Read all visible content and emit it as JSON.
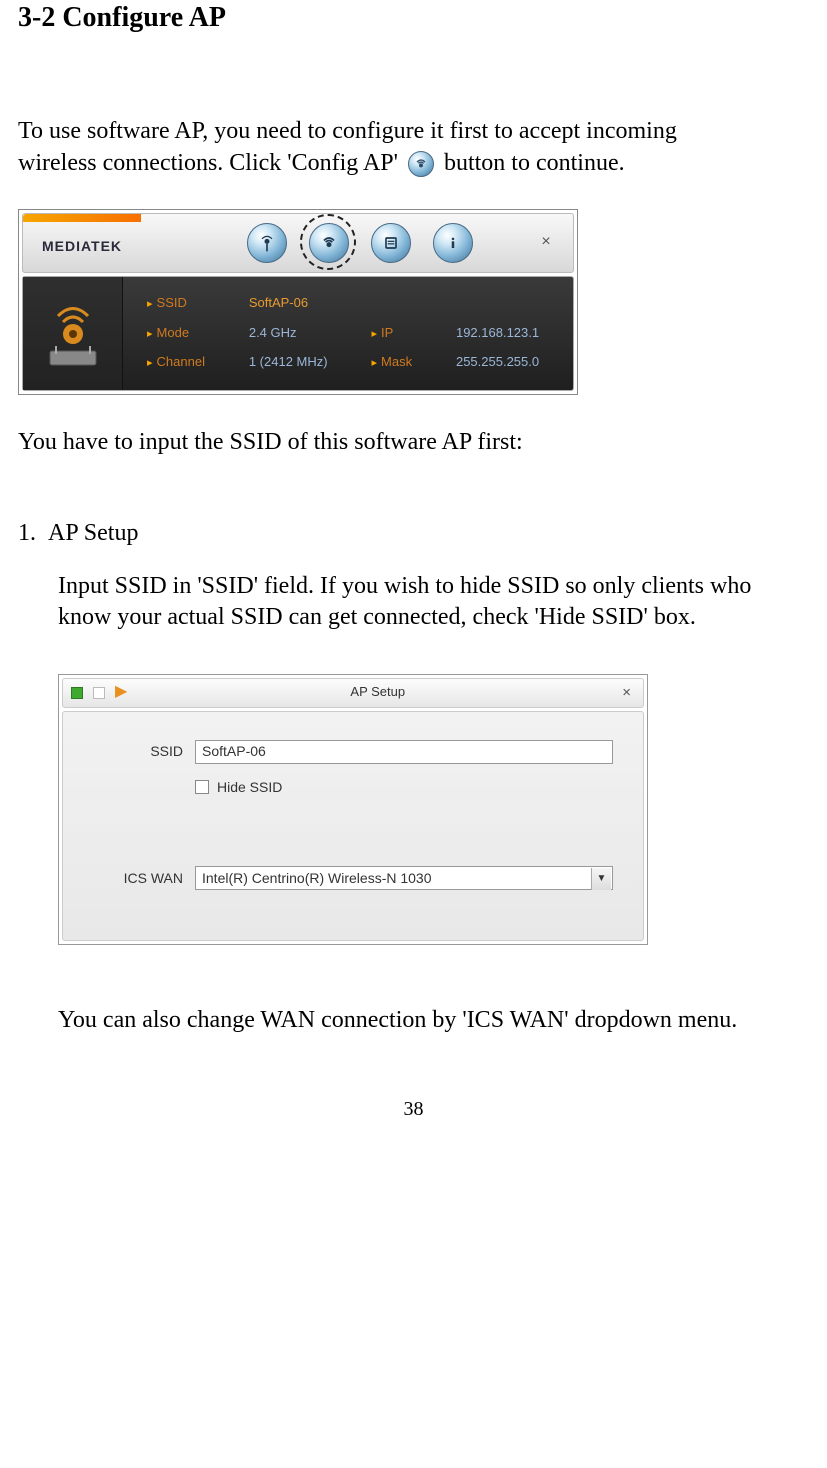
{
  "page": {
    "heading": "3-2 Configure AP",
    "intro_line1": "To use software AP, you need to configure it first to accept incoming",
    "intro_line2a": "wireless connections. Click 'Config AP' ",
    "intro_line2b": " button to continue.",
    "caption1": "You have to input the SSID of this software AP first:",
    "list_number": "1.",
    "list_title": "AP Setup",
    "para3": "Input SSID in 'SSID' field. If you wish to hide SSID so only clients who know your actual SSID can get connected, check 'Hide SSID' box.",
    "para4": "You can also change WAN connection by 'ICS WAN' dropdown menu.",
    "page_number": "38"
  },
  "shot1": {
    "brand": "MEDIATEK",
    "labels": {
      "ssid": "SSID",
      "mode": "Mode",
      "channel": "Channel",
      "ip": "IP",
      "mask": "Mask"
    },
    "values": {
      "ssid": "SoftAP-06",
      "mode": "2.4 GHz",
      "channel": "1 (2412 MHz)",
      "ip": "192.168.123.1",
      "mask": "255.255.255.0"
    },
    "close": "×"
  },
  "shot2": {
    "title": "AP Setup",
    "close": "×",
    "arrow": "▶",
    "labels": {
      "ssid": "SSID",
      "hide_ssid": "Hide SSID",
      "ics_wan": "ICS WAN"
    },
    "values": {
      "ssid": "SoftAP-06",
      "ics_wan": "Intel(R) Centrino(R) Wireless-N 1030"
    },
    "dropdown_arrow": "▼"
  }
}
